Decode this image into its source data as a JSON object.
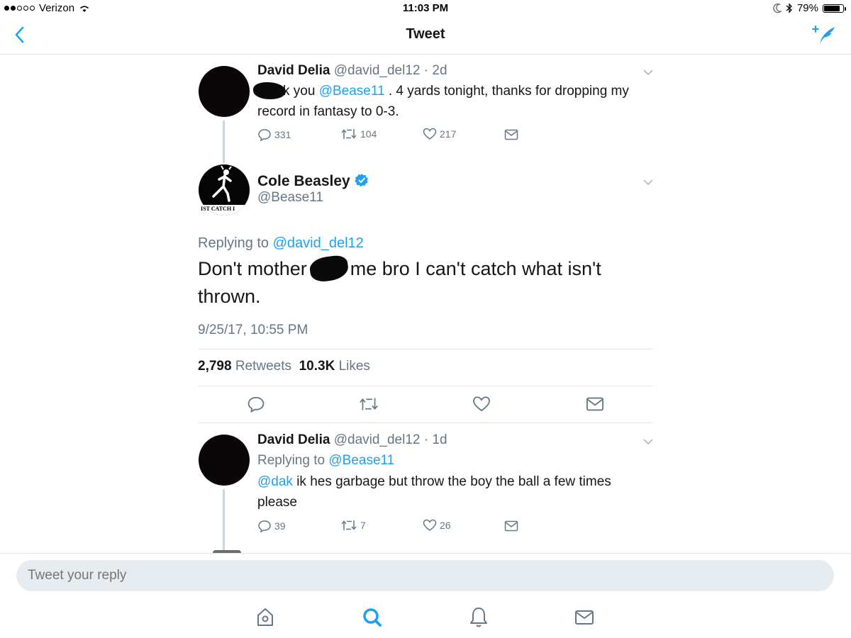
{
  "status_bar": {
    "carrier": "Verizon",
    "time": "11:03 PM",
    "battery": "79%"
  },
  "nav": {
    "title": "Tweet"
  },
  "tweets": [
    {
      "name": "David Delia",
      "handle": "@david_del12",
      "time": "2d",
      "text_before": "k you ",
      "mention": "@Bease11",
      "text_after": " . 4 yards tonight, thanks for dropping my record in fantasy to 0-3.",
      "replies": "331",
      "retweets": "104",
      "likes": "217"
    },
    {
      "name": "David Delia",
      "handle": "@david_del12",
      "time": "1d",
      "replying_label": "Replying to ",
      "replying_to": "@Bease11",
      "mention": "@dak",
      "text": " ik hes garbage but throw the boy the ball a few times please",
      "replies": "39",
      "retweets": "7",
      "likes": "26"
    }
  ],
  "main_tweet": {
    "name": "Cole Beasley",
    "handle": "@Bease11",
    "avatar_text": "IST CATCH I",
    "replying_label": "Replying to ",
    "replying_to": "@david_del12",
    "text_part1": "Don't mother ",
    "text_part2": " me bro I can't catch what isn't thrown.",
    "timestamp": "9/25/17, 10:55 PM",
    "retweets_count": "2,798",
    "retweets_label": "Retweets",
    "likes_count": "10.3K",
    "likes_label": "Likes"
  },
  "composer": {
    "placeholder": "Tweet your reply"
  },
  "icons": [
    "back-icon",
    "compose-icon",
    "reply-icon",
    "retweet-icon",
    "like-icon",
    "dm-icon",
    "verified-icon",
    "home-icon",
    "search-icon",
    "notifications-icon",
    "messages-icon"
  ],
  "colors": {
    "accent": "#1da1f2",
    "text": "#14171a",
    "muted": "#657786",
    "verified": "#1da1f2"
  }
}
